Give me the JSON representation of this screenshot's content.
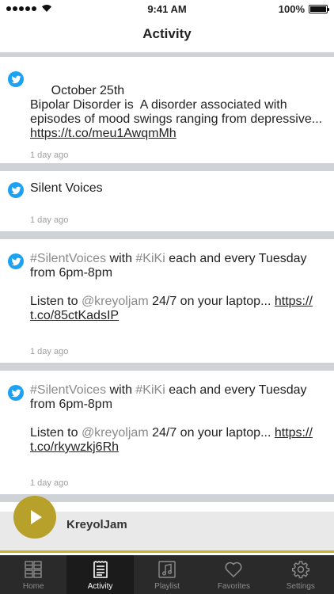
{
  "status_bar": {
    "time": "9:41 AM",
    "battery": "100%"
  },
  "header": {
    "title": "Activity"
  },
  "feed": {
    "items": [
      {
        "date_line": "October 25th",
        "text": "Bipolar Disorder is  A disorder associated with episodes of mood swings ranging from depressive... ",
        "link": "https://t.co/meu1AwqmMh",
        "time": "1 day ago"
      },
      {
        "text": "Silent Voices",
        "time": "1 day ago"
      },
      {
        "hashtag1": "#SilentVoices",
        "with": " with ",
        "hashtag2": "#KiKi",
        "rest": " each and every Tuesday from 6pm-8pm",
        "listen": "Listen to ",
        "mention": "@kreyoljam",
        "after": " 24/7 on your laptop... ",
        "link_a": "https://",
        "link_b": "t.co/85ctKadsIP",
        "time": "1 day ago"
      },
      {
        "hashtag1": "#SilentVoices",
        "with": " with ",
        "hashtag2": "#KiKi",
        "rest": " each and every Tuesday from 6pm-8pm",
        "listen": "Listen to ",
        "mention": "@kreyoljam",
        "after": " 24/7 on your laptop... ",
        "link_a": "https://",
        "link_b": "t.co/rkywzkj6Rh",
        "time": "1 day ago"
      }
    ]
  },
  "player": {
    "station": "KreyolJam"
  },
  "tabs": [
    {
      "label": "Home",
      "icon": "grid-icon"
    },
    {
      "label": "Activity",
      "icon": "document-icon",
      "active": true
    },
    {
      "label": "Playlist",
      "icon": "music-note-icon"
    },
    {
      "label": "Favorites",
      "icon": "heart-icon"
    },
    {
      "label": "Settings",
      "icon": "gear-icon"
    }
  ],
  "colors": {
    "accent": "#b8a12a",
    "twitter": "#1da1f2",
    "tab_bar": "#2a2a2a"
  }
}
